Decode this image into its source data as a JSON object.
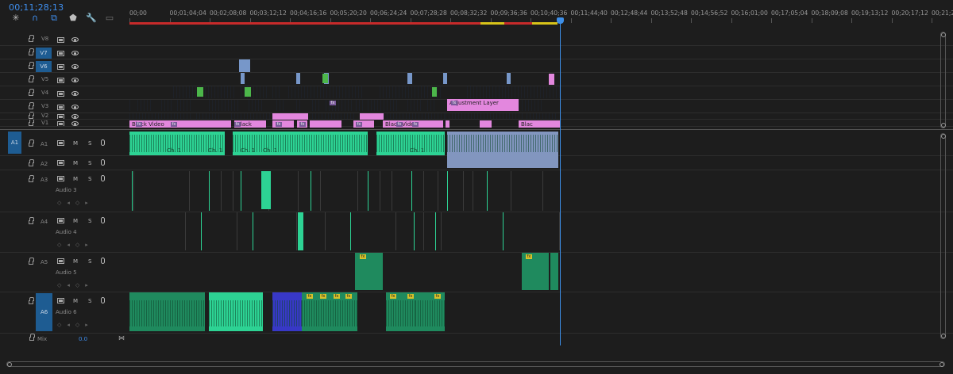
{
  "timecode": "00;11;28;13",
  "toolbar": {
    "icons": [
      "snap-icon",
      "magnet-icon",
      "linked-selection-icon",
      "marker-icon",
      "wrench-icon",
      "captions-icon"
    ]
  },
  "ruler": {
    "ticks": [
      "00;00",
      "00;01;04;04",
      "00;02;08;08",
      "00;03;12;12",
      "00;04;16;16",
      "00;05;20;20",
      "00;06;24;24",
      "00;07;28;28",
      "00;08;32;32",
      "00;09;36;36",
      "00;10;40;36",
      "00;11;44;40",
      "00;12;48;44",
      "00;13;52;48",
      "00;14;56;52",
      "00;16;01;00",
      "00;17;05;04",
      "00;18;09;08",
      "00;19;13;12",
      "00;20;17;12",
      "00;21;21;"
    ]
  },
  "video_tracks": [
    {
      "id": "V8",
      "targeted": false
    },
    {
      "id": "V7",
      "targeted": true
    },
    {
      "id": "V6",
      "targeted": true
    },
    {
      "id": "V5",
      "targeted": false
    },
    {
      "id": "V4",
      "targeted": false
    },
    {
      "id": "V3",
      "targeted": false
    },
    {
      "id": "V2",
      "targeted": false
    },
    {
      "id": "V1",
      "targeted": false
    }
  ],
  "audio_tracks": [
    {
      "id": "A1",
      "patch": "A1",
      "name": "",
      "mute": "M",
      "solo": "S"
    },
    {
      "id": "A2",
      "patch": "",
      "name": "",
      "mute": "M",
      "solo": "S"
    },
    {
      "id": "A3",
      "patch": "",
      "name": "Audio 3",
      "mute": "M",
      "solo": "S"
    },
    {
      "id": "A4",
      "patch": "",
      "name": "Audio 4",
      "mute": "M",
      "solo": "S"
    },
    {
      "id": "A5",
      "patch": "",
      "name": "Audio 5",
      "mute": "M",
      "solo": "S"
    },
    {
      "id": "A6",
      "patch": "",
      "name": "Audio 6",
      "mute": "M",
      "solo": "S"
    }
  ],
  "clip_labels": {
    "black_video_1": "Black Video",
    "black_video_2": "Black",
    "black_video_3": "Black Video",
    "black_video_4": "Blac",
    "adjustment_layer": "Adjustment Layer",
    "fx": "fx",
    "ch1": "Ch. 1",
    "r": "R"
  },
  "mix": {
    "label": "Mix",
    "value": "0.0"
  },
  "colors": {
    "video_clip": "#7797c9",
    "black_video": "#e387de",
    "audio_clip": "#2dd394",
    "playhead": "#3d8fe8",
    "timecode": "#3f8ff0"
  }
}
